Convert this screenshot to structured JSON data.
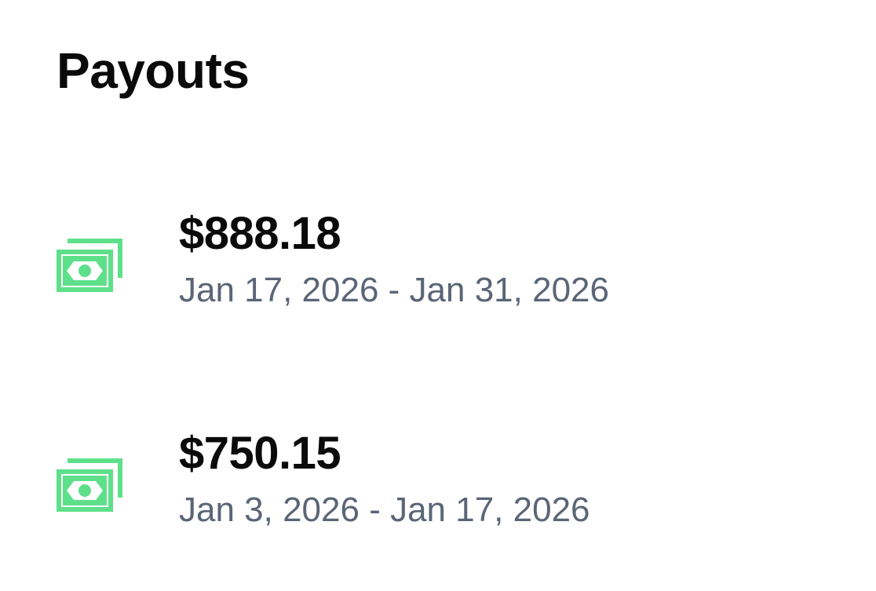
{
  "page": {
    "title": "Payouts"
  },
  "colors": {
    "icon_green": "#5ee08a",
    "amount_text": "#0a0a0a",
    "date_text": "#5b6577",
    "background": "#ffffff"
  },
  "payouts": [
    {
      "icon": "money-bills-icon",
      "amount": "$888.18",
      "date_range": "Jan 17, 2026 - Jan 31, 2026"
    },
    {
      "icon": "money-bills-icon",
      "amount": "$750.15",
      "date_range": "Jan 3, 2026 - Jan 17, 2026"
    }
  ]
}
